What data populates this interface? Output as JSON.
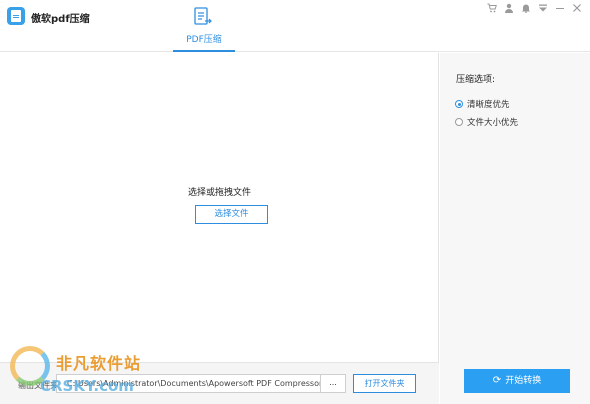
{
  "app": {
    "title": "傲软pdf压缩"
  },
  "tabs": [
    {
      "label": "PDF压缩",
      "active": true
    }
  ],
  "window_controls": [
    "cart-icon",
    "user-icon",
    "bell-icon",
    "menu-icon",
    "minimize-icon",
    "close-icon"
  ],
  "main": {
    "drop_text": "选择或拖拽文件",
    "select_button": "选择文件"
  },
  "output": {
    "label": "输出文件夹:",
    "path": "C:\\Users\\Administrator\\Documents\\Apowersoft PDF Compressor",
    "browse_label": "...",
    "open_folder_label": "打开文件夹"
  },
  "options": {
    "title": "压缩选项:",
    "items": [
      {
        "label": "清晰度优先",
        "selected": true
      },
      {
        "label": "文件大小优先",
        "selected": false
      }
    ],
    "start_button": "开始转换"
  },
  "watermark": {
    "text_cn": "非凡软件站",
    "text_en": "CRSKY.com"
  },
  "colors": {
    "accent": "#2d8ee0",
    "start_button": "#2b9ff2"
  }
}
